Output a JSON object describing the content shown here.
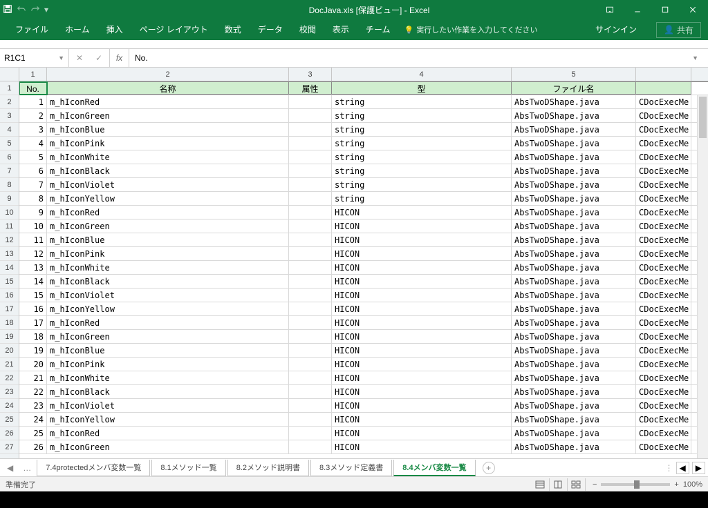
{
  "title": "DocJava.xls  [保護ビュー] - Excel",
  "qat": {
    "save": "save-icon",
    "undo": "undo-icon",
    "redo": "redo-icon"
  },
  "ribbon": {
    "tabs": [
      "ファイル",
      "ホーム",
      "挿入",
      "ページ レイアウト",
      "数式",
      "データ",
      "校閲",
      "表示",
      "チーム"
    ],
    "tellme": "実行したい作業を入力してください",
    "signin": "サインイン",
    "share": "共有"
  },
  "namebox": "R1C1",
  "formula": "No.",
  "colNumbers": [
    "1",
    "2",
    "3",
    "4",
    "5"
  ],
  "headers": {
    "c1": "No.",
    "c2": "名称",
    "c3": "属性",
    "c4": "型",
    "c5": "ファイル名"
  },
  "rows": [
    {
      "no": "1",
      "name": "m_hIconRed",
      "attr": "",
      "type": "string",
      "file": "AbsTwoDShape.java",
      "extra": "CDocExecMe"
    },
    {
      "no": "2",
      "name": "m_hIconGreen",
      "attr": "",
      "type": "string",
      "file": "AbsTwoDShape.java",
      "extra": "CDocExecMe"
    },
    {
      "no": "3",
      "name": "m_hIconBlue",
      "attr": "",
      "type": "string",
      "file": "AbsTwoDShape.java",
      "extra": "CDocExecMe"
    },
    {
      "no": "4",
      "name": "m_hIconPink",
      "attr": "",
      "type": "string",
      "file": "AbsTwoDShape.java",
      "extra": "CDocExecMe"
    },
    {
      "no": "5",
      "name": "m_hIconWhite",
      "attr": "",
      "type": "string",
      "file": "AbsTwoDShape.java",
      "extra": "CDocExecMe"
    },
    {
      "no": "6",
      "name": "m_hIconBlack",
      "attr": "",
      "type": "string",
      "file": "AbsTwoDShape.java",
      "extra": "CDocExecMe"
    },
    {
      "no": "7",
      "name": "m_hIconViolet",
      "attr": "",
      "type": "string",
      "file": "AbsTwoDShape.java",
      "extra": "CDocExecMe"
    },
    {
      "no": "8",
      "name": "m_hIconYellow",
      "attr": "",
      "type": "string",
      "file": "AbsTwoDShape.java",
      "extra": "CDocExecMe"
    },
    {
      "no": "9",
      "name": "m_hIconRed",
      "attr": "",
      "type": "HICON",
      "file": "AbsTwoDShape.java",
      "extra": "CDocExecMe"
    },
    {
      "no": "10",
      "name": "m_hIconGreen",
      "attr": "",
      "type": "HICON",
      "file": "AbsTwoDShape.java",
      "extra": "CDocExecMe"
    },
    {
      "no": "11",
      "name": "m_hIconBlue",
      "attr": "",
      "type": "HICON",
      "file": "AbsTwoDShape.java",
      "extra": "CDocExecMe"
    },
    {
      "no": "12",
      "name": "m_hIconPink",
      "attr": "",
      "type": "HICON",
      "file": "AbsTwoDShape.java",
      "extra": "CDocExecMe"
    },
    {
      "no": "13",
      "name": "m_hIconWhite",
      "attr": "",
      "type": "HICON",
      "file": "AbsTwoDShape.java",
      "extra": "CDocExecMe"
    },
    {
      "no": "14",
      "name": "m_hIconBlack",
      "attr": "",
      "type": "HICON",
      "file": "AbsTwoDShape.java",
      "extra": "CDocExecMe"
    },
    {
      "no": "15",
      "name": "m_hIconViolet",
      "attr": "",
      "type": "HICON",
      "file": "AbsTwoDShape.java",
      "extra": "CDocExecMe"
    },
    {
      "no": "16",
      "name": "m_hIconYellow",
      "attr": "",
      "type": "HICON",
      "file": "AbsTwoDShape.java",
      "extra": "CDocExecMe"
    },
    {
      "no": "17",
      "name": "m_hIconRed",
      "attr": "",
      "type": "HICON",
      "file": "AbsTwoDShape.java",
      "extra": "CDocExecMe"
    },
    {
      "no": "18",
      "name": "m_hIconGreen",
      "attr": "",
      "type": "HICON",
      "file": "AbsTwoDShape.java",
      "extra": "CDocExecMe"
    },
    {
      "no": "19",
      "name": "m_hIconBlue",
      "attr": "",
      "type": "HICON",
      "file": "AbsTwoDShape.java",
      "extra": "CDocExecMe"
    },
    {
      "no": "20",
      "name": "m_hIconPink",
      "attr": "",
      "type": "HICON",
      "file": "AbsTwoDShape.java",
      "extra": "CDocExecMe"
    },
    {
      "no": "21",
      "name": "m_hIconWhite",
      "attr": "",
      "type": "HICON",
      "file": "AbsTwoDShape.java",
      "extra": "CDocExecMe"
    },
    {
      "no": "22",
      "name": "m_hIconBlack",
      "attr": "",
      "type": "HICON",
      "file": "AbsTwoDShape.java",
      "extra": "CDocExecMe"
    },
    {
      "no": "23",
      "name": "m_hIconViolet",
      "attr": "",
      "type": "HICON",
      "file": "AbsTwoDShape.java",
      "extra": "CDocExecMe"
    },
    {
      "no": "24",
      "name": "m_hIconYellow",
      "attr": "",
      "type": "HICON",
      "file": "AbsTwoDShape.java",
      "extra": "CDocExecMe"
    },
    {
      "no": "25",
      "name": "m_hIconRed",
      "attr": "",
      "type": "HICON",
      "file": "AbsTwoDShape.java",
      "extra": "CDocExecMe"
    },
    {
      "no": "26",
      "name": "m_hIconGreen",
      "attr": "",
      "type": "HICON",
      "file": "AbsTwoDShape.java",
      "extra": "CDocExecMe"
    }
  ],
  "sheetTabs": {
    "ellipsis": "…",
    "tabs": [
      "7.4protectedメンバ変数一覧",
      "8.1メソッド一覧",
      "8.2メソッド説明書",
      "8.3メソッド定義書",
      "8.4メンバ変数一覧"
    ],
    "activeIndex": 4
  },
  "status": {
    "ready": "準備完了",
    "zoom": "100%"
  }
}
